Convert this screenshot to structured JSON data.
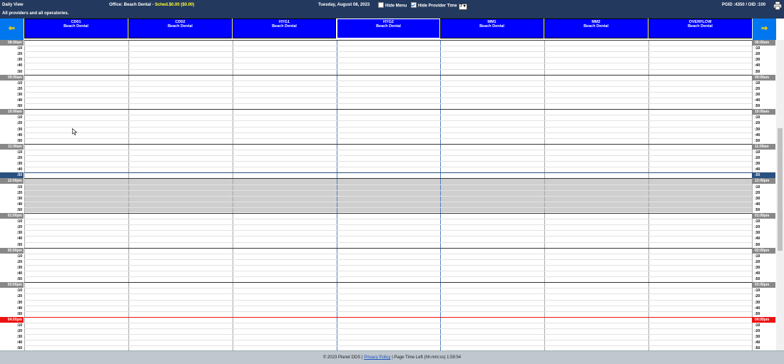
{
  "topbar": {
    "view_title": "Daily View",
    "office_label": "Office: Beach Dental - ",
    "sched_amount": "Sched.$0.00 ($0.00)",
    "filter_text": "All providers and all operatories.",
    "date": "Tuesday, August 08, 2023",
    "hide_menu_label": "Hide Menu",
    "hide_menu_checked": false,
    "hide_provider_time_label": "Hide Provider Time",
    "hide_provider_time_checked": true,
    "interval_value": "7",
    "ids": "PGID :4350  /  OID :100"
  },
  "nav": {
    "prev_icon": "arrow-left-icon",
    "next_icon": "arrow-right-icon",
    "prev_glyph": "⇐",
    "next_glyph": "⇒"
  },
  "operatories": [
    {
      "name": "CD01",
      "office": "Beach Dental"
    },
    {
      "name": "CD02",
      "office": "Beach Dental"
    },
    {
      "name": "HYG1",
      "office": "Beach Dental"
    },
    {
      "name": "HYG2",
      "office": "Beach Dental"
    },
    {
      "name": "MM1",
      "office": "Beach Dental"
    },
    {
      "name": "MM2",
      "office": "Beach Dental"
    },
    {
      "name": "OVERFLOW",
      "office": "Beach Dental"
    }
  ],
  "time_slots": [
    {
      "label": "08:00am",
      "kind": "hour"
    },
    {
      "label": ":10",
      "kind": ""
    },
    {
      "label": ":20",
      "kind": ""
    },
    {
      "label": ":30",
      "kind": ""
    },
    {
      "label": ":40",
      "kind": ""
    },
    {
      "label": ":50",
      "kind": ""
    },
    {
      "label": "09:00am",
      "kind": "hour"
    },
    {
      "label": ":10",
      "kind": ""
    },
    {
      "label": ":20",
      "kind": ""
    },
    {
      "label": ":30",
      "kind": ""
    },
    {
      "label": ":40",
      "kind": ""
    },
    {
      "label": ":50",
      "kind": ""
    },
    {
      "label": "10:00am",
      "kind": "hour"
    },
    {
      "label": ":10",
      "kind": ""
    },
    {
      "label": ":20",
      "kind": ""
    },
    {
      "label": ":30",
      "kind": ""
    },
    {
      "label": ":40",
      "kind": ""
    },
    {
      "label": ":50",
      "kind": ""
    },
    {
      "label": "11:00am",
      "kind": "hour"
    },
    {
      "label": ":10",
      "kind": ""
    },
    {
      "label": ":20",
      "kind": ""
    },
    {
      "label": ":30",
      "kind": ""
    },
    {
      "label": ":40",
      "kind": ""
    },
    {
      "label": ":50",
      "kind": "cur"
    },
    {
      "label": "12:00pm",
      "kind": "hour"
    },
    {
      "label": ":10",
      "kind": ""
    },
    {
      "label": ":20",
      "kind": ""
    },
    {
      "label": ":30",
      "kind": ""
    },
    {
      "label": ":40",
      "kind": ""
    },
    {
      "label": ":50",
      "kind": ""
    },
    {
      "label": "01:00pm",
      "kind": "hour"
    },
    {
      "label": ":10",
      "kind": ""
    },
    {
      "label": ":20",
      "kind": ""
    },
    {
      "label": ":30",
      "kind": ""
    },
    {
      "label": ":40",
      "kind": ""
    },
    {
      "label": ":50",
      "kind": ""
    },
    {
      "label": "02:00pm",
      "kind": "hour"
    },
    {
      "label": ":10",
      "kind": ""
    },
    {
      "label": ":20",
      "kind": ""
    },
    {
      "label": ":30",
      "kind": ""
    },
    {
      "label": ":40",
      "kind": ""
    },
    {
      "label": ":50",
      "kind": ""
    },
    {
      "label": "03:00pm",
      "kind": "hour"
    },
    {
      "label": ":10",
      "kind": ""
    },
    {
      "label": ":20",
      "kind": ""
    },
    {
      "label": ":30",
      "kind": ""
    },
    {
      "label": ":40",
      "kind": ""
    },
    {
      "label": ":50",
      "kind": ""
    },
    {
      "label": "04:00pm",
      "kind": "now"
    },
    {
      "label": ":10",
      "kind": ""
    },
    {
      "label": ":20",
      "kind": ""
    },
    {
      "label": ":30",
      "kind": ""
    },
    {
      "label": ":40",
      "kind": ""
    },
    {
      "label": ":50",
      "kind": ""
    }
  ],
  "colors": {
    "header_blue": "#0000ff",
    "topbar": "#23395d",
    "current_row": "#2a5080",
    "now_row": "#ee1111",
    "lunch": "#cfcfcf"
  },
  "footer": {
    "copyright": "© 2023 Planet DDS | ",
    "privacy_link": "Privacy Policy",
    "time_left": " | Page Time Left (hh:mm:ss) 1:59:54"
  }
}
